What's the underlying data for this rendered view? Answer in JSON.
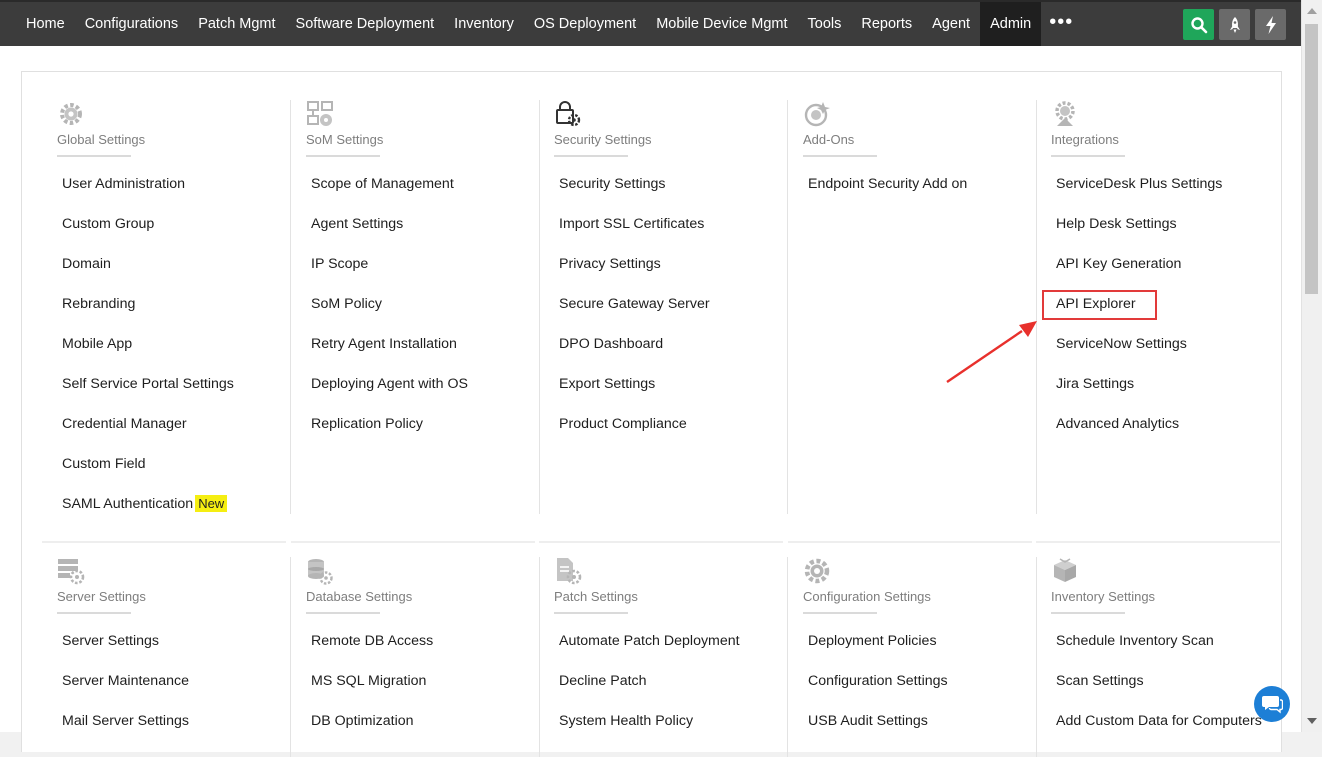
{
  "nav": {
    "items": [
      {
        "label": "Home"
      },
      {
        "label": "Configurations"
      },
      {
        "label": "Patch Mgmt"
      },
      {
        "label": "Software Deployment"
      },
      {
        "label": "Inventory"
      },
      {
        "label": "OS Deployment"
      },
      {
        "label": "Mobile Device Mgmt"
      },
      {
        "label": "Tools"
      },
      {
        "label": "Reports"
      },
      {
        "label": "Agent"
      },
      {
        "label": "Admin",
        "active": true
      }
    ],
    "more": "•••",
    "buttons": [
      {
        "icon": "search-icon",
        "color": "#1fa65a"
      },
      {
        "icon": "rocket-icon",
        "color": "#6a6a6a"
      },
      {
        "icon": "bolt-icon",
        "color": "#6a6a6a"
      }
    ]
  },
  "sections_top": [
    {
      "title": "Global Settings",
      "icon": "gear-icon",
      "items": [
        "User Administration",
        "Custom Group",
        "Domain",
        "Rebranding",
        "Mobile App",
        "Self Service Portal Settings",
        "Credential Manager",
        "Custom Field",
        "SAML Authentication"
      ]
    },
    {
      "title": "SoM Settings",
      "icon": "network-icon",
      "items": [
        "Scope of Management",
        "Agent Settings",
        "IP Scope",
        "SoM Policy",
        "Retry Agent Installation",
        "Deploying Agent with OS",
        "Replication Policy"
      ]
    },
    {
      "title": "Security Settings",
      "icon": "lock-gear-icon",
      "items": [
        "Security Settings",
        "Import SSL Certificates",
        "Privacy Settings",
        "Secure Gateway Server",
        "DPO Dashboard",
        "Export Settings",
        "Product Compliance"
      ]
    },
    {
      "title": "Add-Ons",
      "icon": "addon-icon",
      "items": [
        "Endpoint Security Add on"
      ]
    },
    {
      "title": "Integrations",
      "icon": "integration-icon",
      "items": [
        "ServiceDesk Plus Settings",
        "Help Desk Settings",
        "API Key Generation",
        "API Explorer",
        "ServiceNow Settings",
        "Jira Settings",
        "Advanced Analytics"
      ]
    }
  ],
  "badge_new": "New",
  "sections_bottom": [
    {
      "title": "Server Settings",
      "icon": "server-gear-icon",
      "items": [
        "Server Settings",
        "Server Maintenance",
        "Mail Server Settings"
      ]
    },
    {
      "title": "Database Settings",
      "icon": "database-icon",
      "items": [
        "Remote DB Access",
        "MS SQL Migration",
        "DB Optimization"
      ]
    },
    {
      "title": "Patch Settings",
      "icon": "patch-doc-icon",
      "items": [
        "Automate Patch Deployment",
        "Decline Patch",
        "System Health Policy"
      ]
    },
    {
      "title": "Configuration Settings",
      "icon": "config-gear-icon",
      "items": [
        "Deployment Policies",
        "Configuration Settings",
        "USB Audit Settings"
      ]
    },
    {
      "title": "Inventory Settings",
      "icon": "box-icon",
      "items": [
        "Schedule Inventory Scan",
        "Scan Settings",
        "Add Custom Data for Computers"
      ]
    }
  ],
  "colors": {
    "accent_green": "#1fa65a",
    "nav_bg": "#3c3c3c",
    "annotation_red": "#e23a3a",
    "chat_blue": "#1d7fd6",
    "badge_yellow": "#f5ee12"
  }
}
